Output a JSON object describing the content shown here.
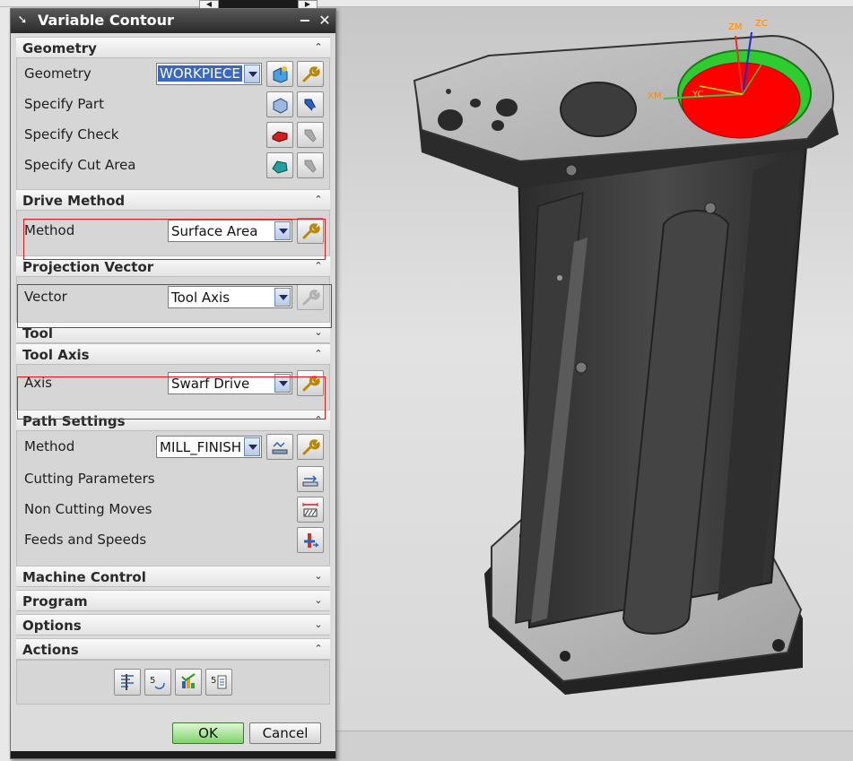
{
  "dialog": {
    "title": "Variable Contour",
    "sections": {
      "geometry": {
        "title": "Geometry",
        "rows": {
          "geometry": {
            "label": "Geometry",
            "value": "WORKPIECE"
          },
          "specify_part": {
            "label": "Specify Part"
          },
          "specify_check": {
            "label": "Specify Check"
          },
          "specify_cut_area": {
            "label": "Specify Cut Area"
          }
        }
      },
      "drive_method": {
        "title": "Drive Method",
        "method_label": "Method",
        "method_value": "Surface Area"
      },
      "projection_vector": {
        "title": "Projection Vector",
        "vector_label": "Vector",
        "vector_value": "Tool Axis"
      },
      "tool": {
        "title": "Tool"
      },
      "tool_axis": {
        "title": "Tool Axis",
        "axis_label": "Axis",
        "axis_value": "Swarf Drive"
      },
      "path_settings": {
        "title": "Path Settings",
        "method_label": "Method",
        "method_value": "MILL_FINISH",
        "cutting_parameters": "Cutting Parameters",
        "non_cutting_moves": "Non Cutting Moves",
        "feeds_and_speeds": "Feeds and Speeds"
      },
      "machine_control": {
        "title": "Machine Control"
      },
      "program": {
        "title": "Program"
      },
      "options": {
        "title": "Options"
      },
      "actions": {
        "title": "Actions"
      }
    },
    "ok_label": "OK",
    "cancel_label": "Cancel"
  },
  "viewport": {
    "triad": {
      "xm": "XM",
      "yc": "YC",
      "zm": "ZM",
      "zc": "ZC",
      "x_small": "YC"
    }
  },
  "colors": {
    "title_bar": "#2f2f2f",
    "highlight_box": "#d61c1c",
    "surface_red": "#ff0000",
    "surface_green": "#2ecc2e",
    "model_dark": "#3c3c3c",
    "ok_button": "#7fd36a"
  },
  "icons": {
    "title_icon": "pin-icon",
    "minimize": "minimize-icon",
    "close": "close-icon"
  }
}
